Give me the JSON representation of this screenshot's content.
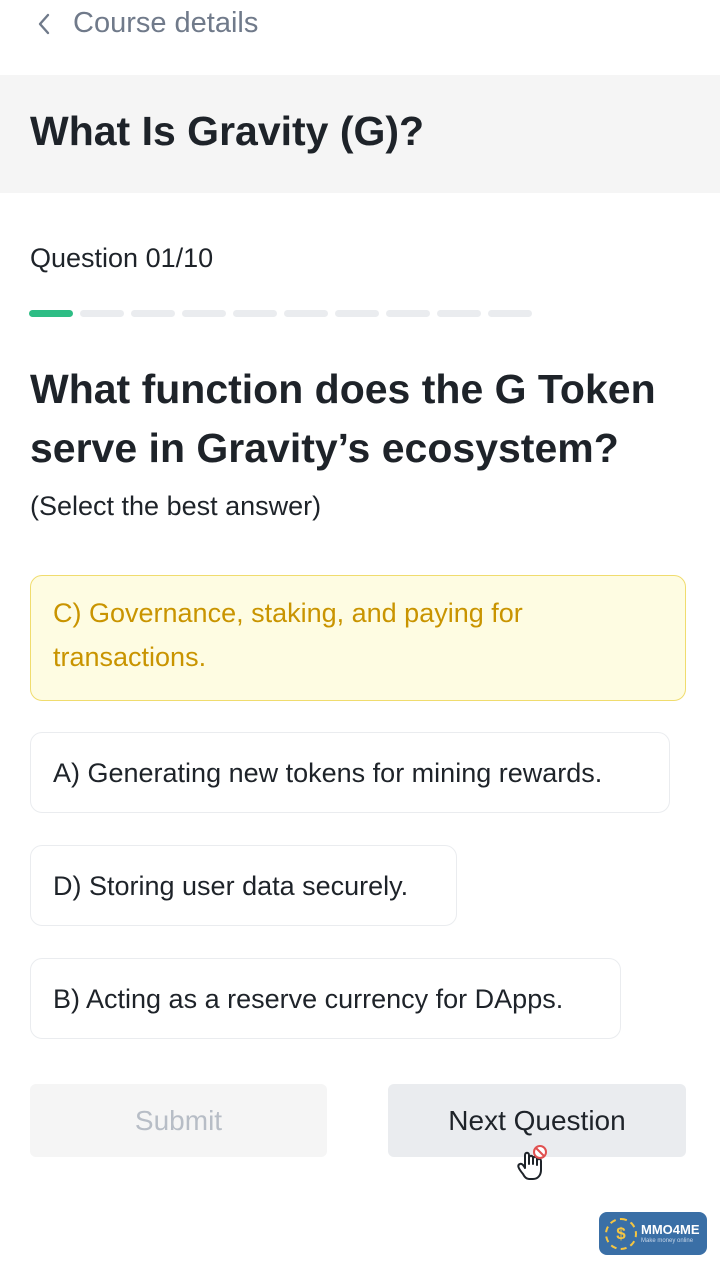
{
  "nav": {
    "title": "Course details",
    "back_icon": "chevron-left-icon"
  },
  "course": {
    "title": "What Is Gravity (G)?"
  },
  "quiz": {
    "counter": "Question 01/10",
    "progress": {
      "current": 1,
      "total": 10
    },
    "question": "What function does the G Token serve in Gravity’s ecosystem?",
    "hint": "(Select the best answer)",
    "options": [
      {
        "text": "C) Governance, staking, and paying for transactions.",
        "selected": true
      },
      {
        "text": "A) Generating new tokens for mining rewards.",
        "selected": false
      },
      {
        "text": "D) Storing user data securely.",
        "selected": false
      },
      {
        "text": "B) Acting as a reserve currency for DApps.",
        "selected": false
      }
    ]
  },
  "actions": {
    "submit_label": "Submit",
    "next_label": "Next Question"
  },
  "watermark": {
    "brand": "MMO4ME",
    "tagline": "Make money online",
    "icon": "dollar-coin-icon"
  },
  "colors": {
    "progress_active": "#2ebd85",
    "selected_bg": "#fefce2",
    "selected_text": "#c99400"
  }
}
